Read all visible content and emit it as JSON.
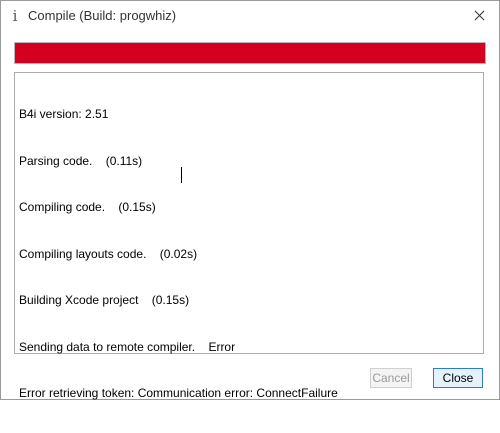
{
  "window": {
    "title": "Compile (Build: progwhiz)",
    "icon": "info-icon"
  },
  "progress": {
    "fraction": 1.0,
    "color": "#d5001f"
  },
  "log": {
    "lines": [
      "B4i version: 2.51",
      "Parsing code.    (0.11s)",
      "Compiling code.    (0.15s)",
      "Compiling layouts code.    (0.02s)",
      "Building Xcode project    (0.15s)",
      "Sending data to remote compiler.    Error",
      "Error retrieving token: Communication error: ConnectFailure"
    ]
  },
  "buttons": {
    "cancel_label": "Cancel",
    "close_label": "Close"
  }
}
